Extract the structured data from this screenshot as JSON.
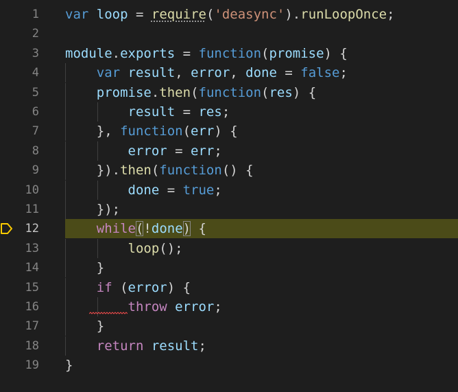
{
  "editor": {
    "breakpoint_icon": "debug-stackframe-arrow-icon",
    "active_line": 12,
    "lines": [
      {
        "num": "1",
        "tokens": [
          [
            "kw",
            "var"
          ],
          [
            "p",
            " "
          ],
          [
            "var",
            "loop"
          ],
          [
            "p",
            " = "
          ],
          [
            "fn",
            "require"
          ],
          [
            "p",
            "("
          ],
          [
            "str",
            "'deasync'"
          ],
          [
            "p",
            ")."
          ],
          [
            "fn",
            "runLoopOnce"
          ],
          [
            "p",
            ";"
          ]
        ]
      },
      {
        "num": "2",
        "tokens": []
      },
      {
        "num": "3",
        "tokens": [
          [
            "var",
            "module"
          ],
          [
            "p",
            "."
          ],
          [
            "var",
            "exports"
          ],
          [
            "p",
            " = "
          ],
          [
            "kw",
            "function"
          ],
          [
            "p",
            "("
          ],
          [
            "var",
            "promise"
          ],
          [
            "p",
            ") {"
          ]
        ]
      },
      {
        "num": "4",
        "tokens": [
          [
            "p",
            "    "
          ],
          [
            "kw",
            "var"
          ],
          [
            "p",
            " "
          ],
          [
            "var",
            "result"
          ],
          [
            "p",
            ", "
          ],
          [
            "var",
            "error"
          ],
          [
            "p",
            ", "
          ],
          [
            "var",
            "done"
          ],
          [
            "p",
            " = "
          ],
          [
            "kw",
            "false"
          ],
          [
            "p",
            ";"
          ]
        ]
      },
      {
        "num": "5",
        "tokens": [
          [
            "p",
            "    "
          ],
          [
            "var",
            "promise"
          ],
          [
            "p",
            "."
          ],
          [
            "fn",
            "then"
          ],
          [
            "p",
            "("
          ],
          [
            "kw",
            "function"
          ],
          [
            "p",
            "("
          ],
          [
            "var",
            "res"
          ],
          [
            "p",
            ") {"
          ]
        ]
      },
      {
        "num": "6",
        "tokens": [
          [
            "p",
            "        "
          ],
          [
            "var",
            "result"
          ],
          [
            "p",
            " = "
          ],
          [
            "var",
            "res"
          ],
          [
            "p",
            ";"
          ]
        ]
      },
      {
        "num": "7",
        "tokens": [
          [
            "p",
            "    }, "
          ],
          [
            "kw",
            "function"
          ],
          [
            "p",
            "("
          ],
          [
            "var",
            "err"
          ],
          [
            "p",
            ") {"
          ]
        ]
      },
      {
        "num": "8",
        "tokens": [
          [
            "p",
            "        "
          ],
          [
            "var",
            "error"
          ],
          [
            "p",
            " = "
          ],
          [
            "var",
            "err"
          ],
          [
            "p",
            ";"
          ]
        ]
      },
      {
        "num": "9",
        "tokens": [
          [
            "p",
            "    })."
          ],
          [
            "fn",
            "then"
          ],
          [
            "p",
            "("
          ],
          [
            "kw",
            "function"
          ],
          [
            "p",
            "() {"
          ]
        ]
      },
      {
        "num": "10",
        "tokens": [
          [
            "p",
            "        "
          ],
          [
            "var",
            "done"
          ],
          [
            "p",
            " = "
          ],
          [
            "kw",
            "true"
          ],
          [
            "p",
            ";"
          ]
        ]
      },
      {
        "num": "11",
        "tokens": [
          [
            "p",
            "    });"
          ]
        ]
      },
      {
        "num": "12",
        "tokens": [
          [
            "p",
            "    "
          ],
          [
            "ctl",
            "while"
          ],
          [
            "pb",
            "("
          ],
          [
            "p",
            "!"
          ],
          [
            "var",
            "done"
          ],
          [
            "pb",
            ")"
          ],
          [
            "p",
            " {"
          ]
        ]
      },
      {
        "num": "13",
        "tokens": [
          [
            "p",
            "        "
          ],
          [
            "fn",
            "loop"
          ],
          [
            "p",
            "();"
          ]
        ]
      },
      {
        "num": "14",
        "tokens": [
          [
            "p",
            "    }"
          ]
        ]
      },
      {
        "num": "15",
        "tokens": [
          [
            "p",
            "    "
          ],
          [
            "ctl",
            "if"
          ],
          [
            "p",
            " ("
          ],
          [
            "var",
            "error"
          ],
          [
            "p",
            ") {"
          ]
        ]
      },
      {
        "num": "16",
        "tokens": [
          [
            "p",
            "        "
          ],
          [
            "ctl",
            "throw"
          ],
          [
            "p",
            " "
          ],
          [
            "var",
            "error"
          ],
          [
            "p",
            ";"
          ]
        ]
      },
      {
        "num": "17",
        "tokens": [
          [
            "p",
            "    }"
          ]
        ]
      },
      {
        "num": "18",
        "tokens": [
          [
            "p",
            "    "
          ],
          [
            "ctl",
            "return"
          ],
          [
            "p",
            " "
          ],
          [
            "var",
            "result"
          ],
          [
            "p",
            ";"
          ]
        ]
      },
      {
        "num": "19",
        "tokens": [
          [
            "p",
            "}"
          ]
        ]
      }
    ],
    "colors": {
      "background": "#1e1e1e",
      "current_line": "#4b4b18",
      "breakpoint_arrow": "#ffcc00",
      "keyword": "#569cd6",
      "control": "#c586c0",
      "variable": "#9cdcfe",
      "function": "#dcdcaa",
      "string": "#ce9178",
      "squiggle": "#f14c4c"
    }
  }
}
